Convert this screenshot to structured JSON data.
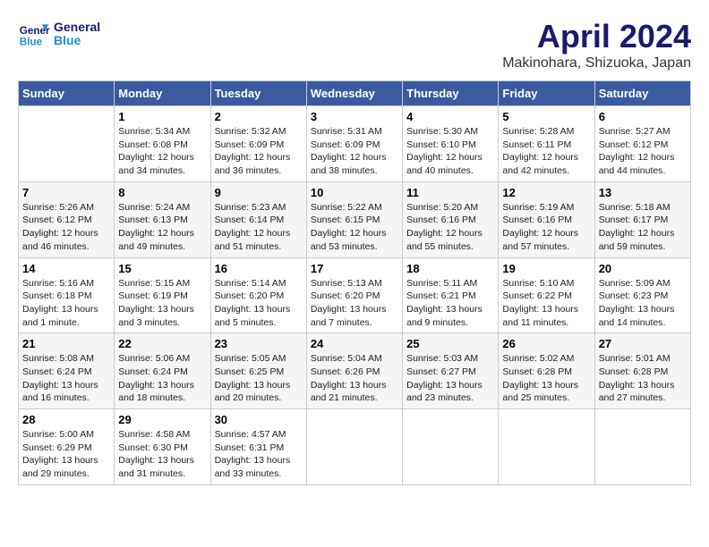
{
  "header": {
    "logo_line1": "General",
    "logo_line2": "Blue",
    "month_title": "April 2024",
    "location": "Makinohara, Shizuoka, Japan"
  },
  "days_of_week": [
    "Sunday",
    "Monday",
    "Tuesday",
    "Wednesday",
    "Thursday",
    "Friday",
    "Saturday"
  ],
  "weeks": [
    [
      {
        "day": "",
        "info": ""
      },
      {
        "day": "1",
        "info": "Sunrise: 5:34 AM\nSunset: 6:08 PM\nDaylight: 12 hours\nand 34 minutes."
      },
      {
        "day": "2",
        "info": "Sunrise: 5:32 AM\nSunset: 6:09 PM\nDaylight: 12 hours\nand 36 minutes."
      },
      {
        "day": "3",
        "info": "Sunrise: 5:31 AM\nSunset: 6:09 PM\nDaylight: 12 hours\nand 38 minutes."
      },
      {
        "day": "4",
        "info": "Sunrise: 5:30 AM\nSunset: 6:10 PM\nDaylight: 12 hours\nand 40 minutes."
      },
      {
        "day": "5",
        "info": "Sunrise: 5:28 AM\nSunset: 6:11 PM\nDaylight: 12 hours\nand 42 minutes."
      },
      {
        "day": "6",
        "info": "Sunrise: 5:27 AM\nSunset: 6:12 PM\nDaylight: 12 hours\nand 44 minutes."
      }
    ],
    [
      {
        "day": "7",
        "info": "Sunrise: 5:26 AM\nSunset: 6:12 PM\nDaylight: 12 hours\nand 46 minutes."
      },
      {
        "day": "8",
        "info": "Sunrise: 5:24 AM\nSunset: 6:13 PM\nDaylight: 12 hours\nand 49 minutes."
      },
      {
        "day": "9",
        "info": "Sunrise: 5:23 AM\nSunset: 6:14 PM\nDaylight: 12 hours\nand 51 minutes."
      },
      {
        "day": "10",
        "info": "Sunrise: 5:22 AM\nSunset: 6:15 PM\nDaylight: 12 hours\nand 53 minutes."
      },
      {
        "day": "11",
        "info": "Sunrise: 5:20 AM\nSunset: 6:16 PM\nDaylight: 12 hours\nand 55 minutes."
      },
      {
        "day": "12",
        "info": "Sunrise: 5:19 AM\nSunset: 6:16 PM\nDaylight: 12 hours\nand 57 minutes."
      },
      {
        "day": "13",
        "info": "Sunrise: 5:18 AM\nSunset: 6:17 PM\nDaylight: 12 hours\nand 59 minutes."
      }
    ],
    [
      {
        "day": "14",
        "info": "Sunrise: 5:16 AM\nSunset: 6:18 PM\nDaylight: 13 hours\nand 1 minute."
      },
      {
        "day": "15",
        "info": "Sunrise: 5:15 AM\nSunset: 6:19 PM\nDaylight: 13 hours\nand 3 minutes."
      },
      {
        "day": "16",
        "info": "Sunrise: 5:14 AM\nSunset: 6:20 PM\nDaylight: 13 hours\nand 5 minutes."
      },
      {
        "day": "17",
        "info": "Sunrise: 5:13 AM\nSunset: 6:20 PM\nDaylight: 13 hours\nand 7 minutes."
      },
      {
        "day": "18",
        "info": "Sunrise: 5:11 AM\nSunset: 6:21 PM\nDaylight: 13 hours\nand 9 minutes."
      },
      {
        "day": "19",
        "info": "Sunrise: 5:10 AM\nSunset: 6:22 PM\nDaylight: 13 hours\nand 11 minutes."
      },
      {
        "day": "20",
        "info": "Sunrise: 5:09 AM\nSunset: 6:23 PM\nDaylight: 13 hours\nand 14 minutes."
      }
    ],
    [
      {
        "day": "21",
        "info": "Sunrise: 5:08 AM\nSunset: 6:24 PM\nDaylight: 13 hours\nand 16 minutes."
      },
      {
        "day": "22",
        "info": "Sunrise: 5:06 AM\nSunset: 6:24 PM\nDaylight: 13 hours\nand 18 minutes."
      },
      {
        "day": "23",
        "info": "Sunrise: 5:05 AM\nSunset: 6:25 PM\nDaylight: 13 hours\nand 20 minutes."
      },
      {
        "day": "24",
        "info": "Sunrise: 5:04 AM\nSunset: 6:26 PM\nDaylight: 13 hours\nand 21 minutes."
      },
      {
        "day": "25",
        "info": "Sunrise: 5:03 AM\nSunset: 6:27 PM\nDaylight: 13 hours\nand 23 minutes."
      },
      {
        "day": "26",
        "info": "Sunrise: 5:02 AM\nSunset: 6:28 PM\nDaylight: 13 hours\nand 25 minutes."
      },
      {
        "day": "27",
        "info": "Sunrise: 5:01 AM\nSunset: 6:28 PM\nDaylight: 13 hours\nand 27 minutes."
      }
    ],
    [
      {
        "day": "28",
        "info": "Sunrise: 5:00 AM\nSunset: 6:29 PM\nDaylight: 13 hours\nand 29 minutes."
      },
      {
        "day": "29",
        "info": "Sunrise: 4:58 AM\nSunset: 6:30 PM\nDaylight: 13 hours\nand 31 minutes."
      },
      {
        "day": "30",
        "info": "Sunrise: 4:57 AM\nSunset: 6:31 PM\nDaylight: 13 hours\nand 33 minutes."
      },
      {
        "day": "",
        "info": ""
      },
      {
        "day": "",
        "info": ""
      },
      {
        "day": "",
        "info": ""
      },
      {
        "day": "",
        "info": ""
      }
    ]
  ]
}
